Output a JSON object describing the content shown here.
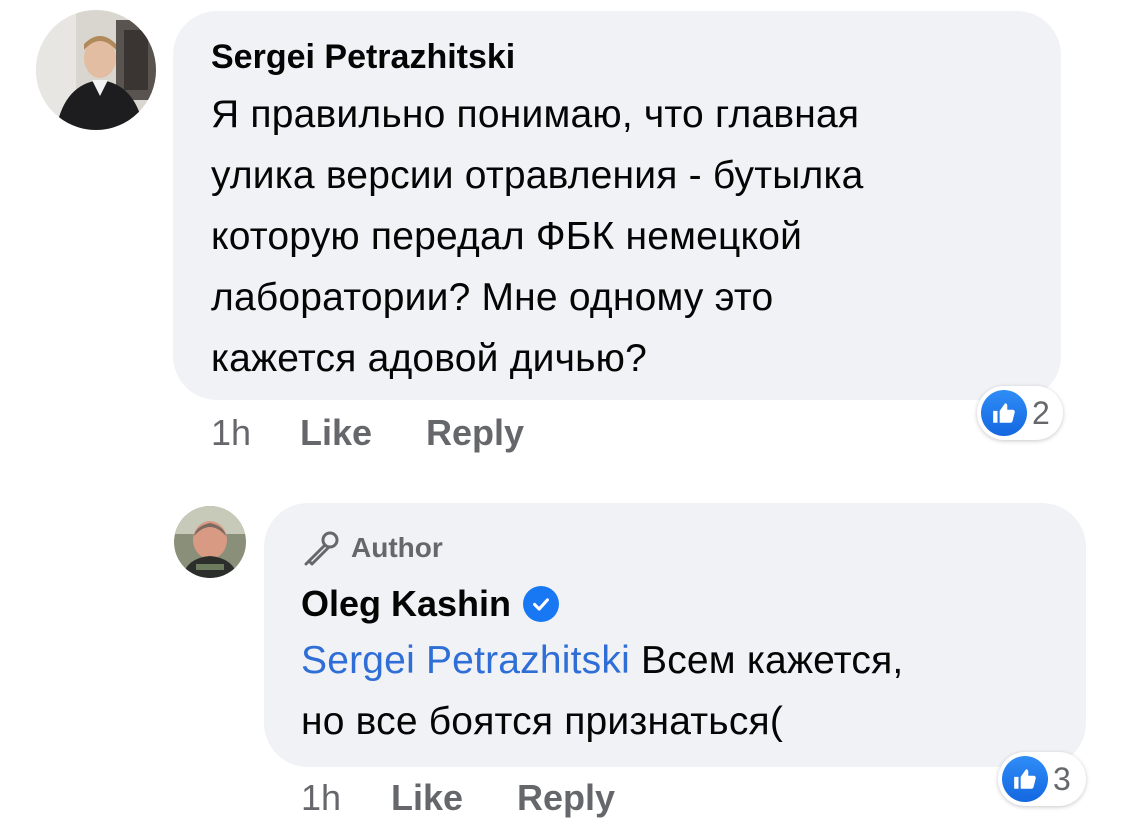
{
  "comment": {
    "author": "Sergei Petrazhitski",
    "text_lines": [
      "Я правильно понимаю, что главная",
      "улика версии отравления - бутылка",
      "которую передал ФБК немецкой",
      "лаборатории? Мне одному это",
      "кажется адовой дичью?"
    ],
    "time": "1h",
    "like_label": "Like",
    "reply_label": "Reply",
    "reaction_count": "2"
  },
  "reply": {
    "badge_label": "Author",
    "author": "Oleg Kashin",
    "mention": "Sergei Petrazhitski",
    "text_line1_rest": "Всем кажется,",
    "text_line2": "но все боятся признаться(",
    "time": "1h",
    "like_label": "Like",
    "reply_label": "Reply",
    "reaction_count": "3"
  },
  "icons": {
    "reaction": "like-icon",
    "verified": "verified-badge-icon",
    "author_badge": "microphone-icon"
  },
  "colors": {
    "bubble": "#f0f2f5",
    "text": "#050505",
    "secondary": "#65676b",
    "mention": "#2e6ed6",
    "like_blue": "#1877f2"
  }
}
